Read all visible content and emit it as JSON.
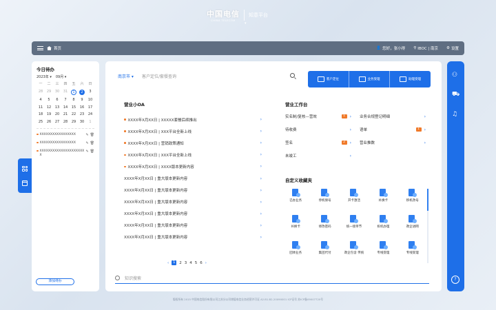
{
  "header": {
    "logo_cn": "中国电信",
    "logo_en": "CHINA TELECOM",
    "platform": "知意平台"
  },
  "topbar": {
    "home": "首页",
    "user": "您好，张小得",
    "location": "IBOC | 南京",
    "settings": "设置"
  },
  "todo": {
    "title": "今日待办",
    "year": "2023年",
    "month": "09月",
    "weekdays": [
      "一",
      "二",
      "三",
      "四",
      "五",
      "六",
      "日"
    ],
    "items": [
      "XXXXXXXXXXXXXXXXX",
      "XXXXXXXXXXXXXXXXX",
      "XXXXXXXXXXXXXXXXXXXXXX"
    ],
    "add": "添加待办"
  },
  "search": {
    "city": "南京市",
    "placeholder": "客户定位/套餐查询"
  },
  "quick": [
    "客户定位",
    "业务受理",
    "助理受理"
  ],
  "oa": {
    "title": "营业小OA",
    "rows": [
      "XXXX年X月XX日 | XXXXX套餐后续推出",
      "XXXX年X月XX日 | XXX平台全新上线",
      "XXXX年X月XX日 | 营销政策通知",
      "XXXX年X月XX日 | XXX平台全新上线",
      "XXXX年X月XX日 | XXXX版本更新内容",
      "XXXX年X月XX日 | 重大版本更新内容",
      "XXXX年X月XX日 | 重大版本更新内容",
      "XXXX年X月XX日 | 重大版本更新内容",
      "XXXX年X月XX日 | 重大版本更新内容",
      "XXXX年X月XX日 | 重大版本更新内容",
      "XXXX年X月XX日 | 重大版本更新内容"
    ]
  },
  "pagination": [
    "1",
    "2",
    "3",
    "4",
    "5",
    "6"
  ],
  "tools": {
    "title": "营业工作台",
    "items": [
      {
        "label": "实名制/复核—营效",
        "badge": "1"
      },
      {
        "label": "业务合规登记明细",
        "badge": ""
      },
      {
        "label": "待收费",
        "badge": ""
      },
      {
        "label": "语单",
        "badge": "1"
      },
      {
        "label": "签名",
        "badge": "2"
      },
      {
        "label": "营业推数",
        "badge": ""
      },
      {
        "label": "未竣工",
        "badge": ""
      }
    ]
  },
  "favs": {
    "title": "自定义收藏夹",
    "items": [
      "已办业务",
      "停机保号",
      "开卡激活",
      "补换卡",
      "移机改号",
      "补换卡",
      "修改密码",
      "统一接单节",
      "拆机办理",
      "政企进网",
      "团体业务",
      "集团代付",
      "政企包含 传统",
      "专线受理",
      "专线受理"
    ]
  },
  "knowledge": {
    "placeholder": "知识搜索"
  },
  "footer": "版权所有 2015 中国电信股份有限公司江苏分公司增值电信业务经营许可证 A2.B1.B2-20090001 ICP证号 苏ICP备09007720号"
}
